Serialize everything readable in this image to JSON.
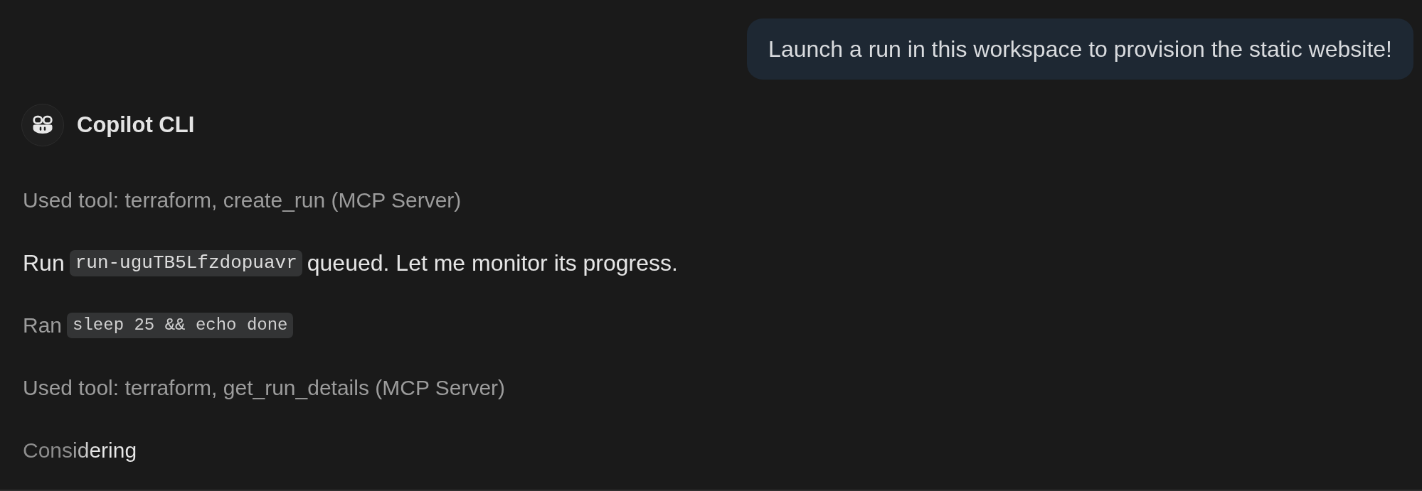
{
  "user_message": {
    "text": "Launch a run in this workspace to provision the static website!"
  },
  "assistant": {
    "name": "Copilot CLI"
  },
  "steps": [
    {
      "kind": "tool",
      "text": "Used tool: terraform, create_run (MCP Server)"
    },
    {
      "kind": "message",
      "parts": [
        {
          "kind": "text",
          "text": "Run"
        },
        {
          "kind": "code",
          "text": "run-uguTB5Lfzdopuavr"
        },
        {
          "kind": "text",
          "text": "queued. Let me monitor its progress."
        }
      ]
    },
    {
      "kind": "command",
      "label": "Ran",
      "command": "sleep 25 && echo done"
    },
    {
      "kind": "tool",
      "text": "Used tool: terraform, get_run_details (MCP Server)"
    },
    {
      "kind": "status",
      "text": "Considering"
    }
  ]
}
